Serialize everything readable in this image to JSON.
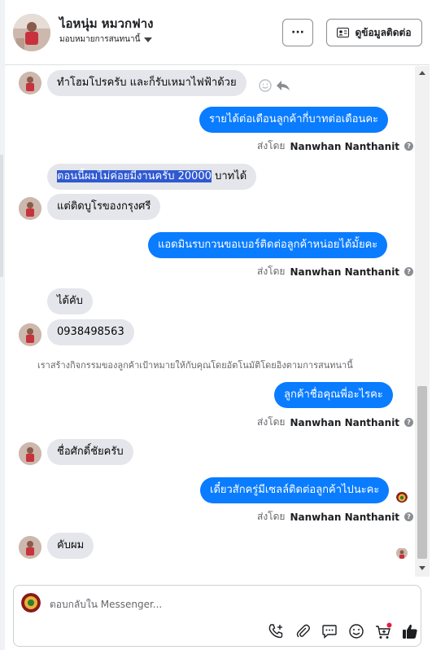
{
  "header": {
    "contact_name": "ไอหนุ่ม หมวกฟาง",
    "assignment": "มอบหมายการสนทนานี้",
    "more_label": "···",
    "contact_info_label": "ดูข้อมูลติดต่อ"
  },
  "messages": [
    {
      "from": "customer",
      "text": "ทำโฮมโปรครับ และก็รับเหมาไฟฟ้าด้วย"
    },
    {
      "from": "page",
      "text": "รายได้ต่อเดือนลูกค้ากี่บาทต่อเดือนคะ"
    },
    {
      "from": "customer",
      "text_highlighted": "ตอนนี้ผมไม่ค่อยมีงานครับ 20000",
      "text_rest": " บาทได้"
    },
    {
      "from": "customer",
      "text": "แต่ติดบูโรของกรุงศรี"
    },
    {
      "from": "page",
      "text": "แอดมินรบกวนขอเบอร์ติดต่อลูกค้าหน่อยได้มั้ยคะ"
    },
    {
      "from": "customer",
      "text": "ได้คับ"
    },
    {
      "from": "customer",
      "text": "0938498563"
    },
    {
      "from": "page",
      "text": "ลูกค้าชื่อคุณพี่อะไรคะ"
    },
    {
      "from": "customer",
      "text": "ชื่อศักดิ์ชัยครับ"
    },
    {
      "from": "page",
      "text": "เดี๋ยวสักครู่มีเซลล์ติดต่อลูกค้าไปนะคะ"
    },
    {
      "from": "customer",
      "text": "คับผม"
    }
  ],
  "sent_by": {
    "prefix": "ส่งโดย",
    "name": "Nanwhan Nanthanit",
    "info": "?"
  },
  "system_notice": "เราสร้างกิจกรรมของลูกค้าเป้าหมายให้กับคุณโดยอัตโนมัติโดยอิงตามการสนทนานี้",
  "composer": {
    "placeholder": "ตอบกลับใน Messenger..."
  },
  "icons": {
    "contact_card": "contact-card-icon",
    "emoji": "emoji-icon",
    "reply": "reply-icon",
    "add_call": "phone-add-icon",
    "attach": "paperclip-icon",
    "saved_replies": "chat-bubble-icon",
    "composer_emoji": "emoji-icon",
    "cart": "cart-icon",
    "like": "thumbs-up-icon"
  },
  "colors": {
    "outgoing_bubble": "#0a7cff",
    "incoming_bubble": "#e4e6eb",
    "highlight": "#2f59d1",
    "cart_dot": "#e41e3f"
  }
}
